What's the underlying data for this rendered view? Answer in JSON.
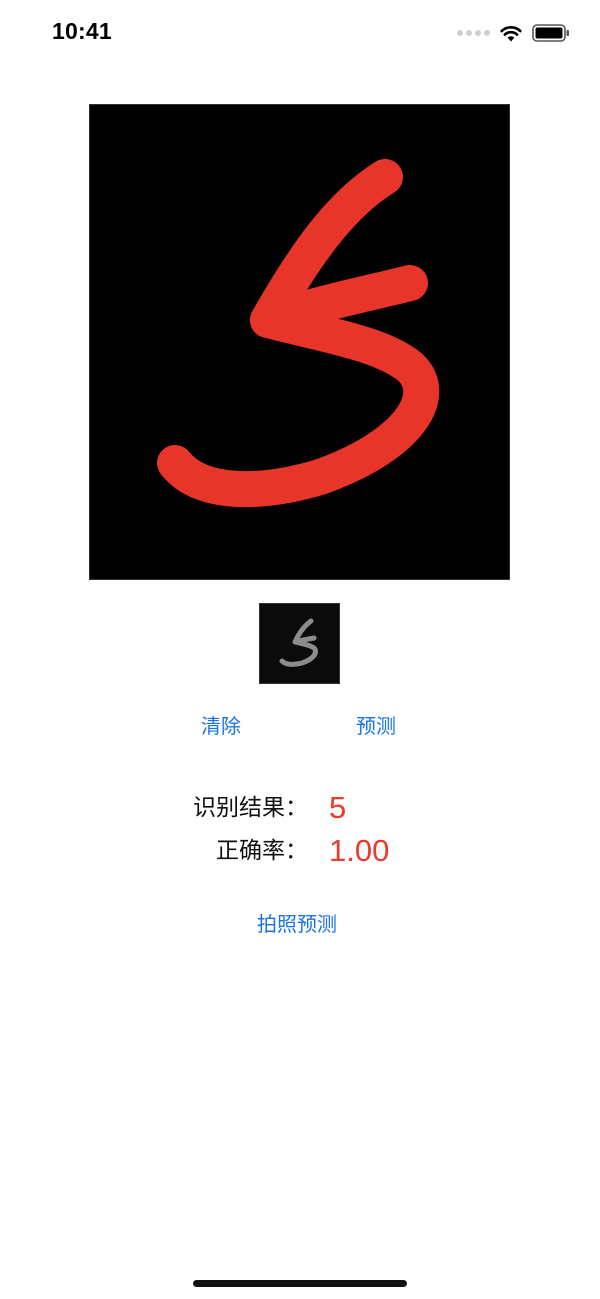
{
  "status_bar": {
    "time": "10:41",
    "icons": [
      "cellular-signal-icon",
      "wifi-icon",
      "battery-icon"
    ]
  },
  "canvas": {
    "background": "#000000",
    "stroke_color": "#e8352a"
  },
  "thumbnail": {
    "background": "#0b0b0b",
    "stroke_color": "#9a9a9a"
  },
  "buttons": {
    "clear_label": "清除",
    "predict_label": "预测",
    "photo_predict_label": "拍照预测"
  },
  "results": {
    "result_label": "识别结果：",
    "result_value": "5",
    "accuracy_label": "正确率：",
    "accuracy_value": "1.00"
  },
  "colors": {
    "accent": "#1a73e8",
    "result": "#ea3a2c"
  }
}
